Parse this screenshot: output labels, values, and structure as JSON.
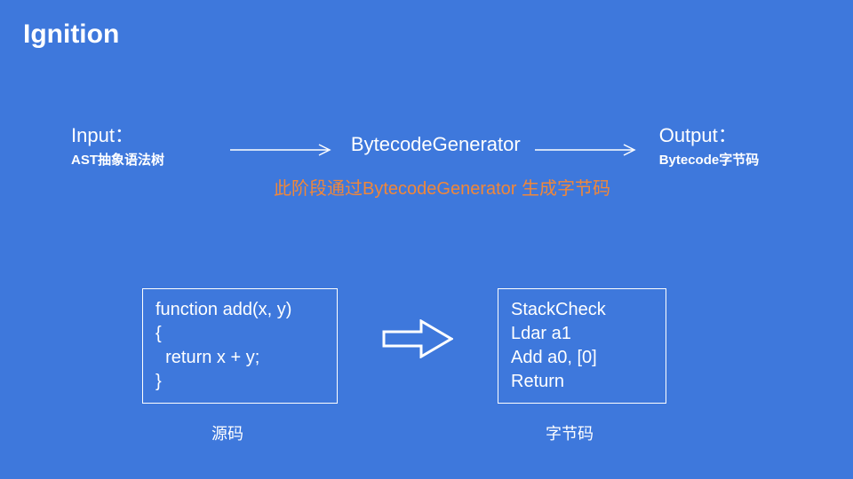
{
  "title": "Ignition",
  "flow": {
    "input": {
      "label": "Input：",
      "sub": "AST抽象语法树"
    },
    "center": "BytecodeGenerator",
    "output": {
      "label": "Output：",
      "sub": "Bytecode字节码"
    }
  },
  "note": "此阶段通过BytecodeGenerator\n生成字节码",
  "source": {
    "code": "function add(x, y)\n{\n  return x + y;\n}",
    "caption": "源码"
  },
  "bytecode": {
    "code": "StackCheck\nLdar a1\nAdd a0, [0]\nReturn",
    "caption": "字节码"
  },
  "colors": {
    "bg": "#3e78dc",
    "accent": "#f0873a",
    "fg": "#ffffff"
  }
}
